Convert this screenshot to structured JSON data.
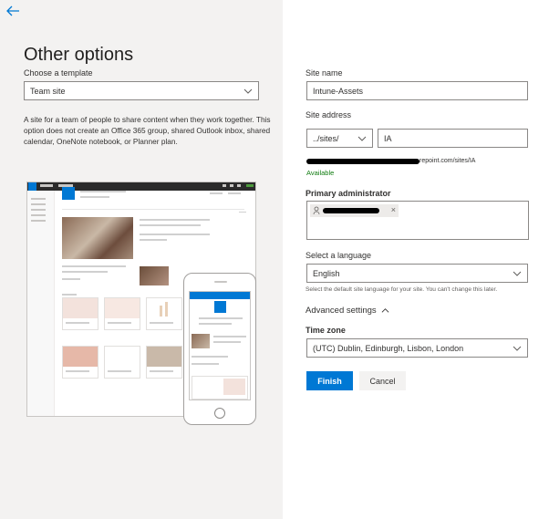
{
  "left": {
    "title": "Other options",
    "template_label": "Choose a template",
    "template_value": "Team site",
    "description": "A site for a team of people to share content when they work together. This option does not create an Office 365 group, shared Outlook inbox, shared calendar, OneNote notebook, or Planner plan.",
    "preview": {
      "suite_brand": "Office 365",
      "app_name": "SharePoint"
    }
  },
  "right": {
    "site_name_label": "Site name",
    "site_name_value": "Intune-Assets",
    "site_address_label": "Site address",
    "site_address_path": "../sites/",
    "site_address_value": "IA",
    "url_tail": "repoint.com/sites/IA",
    "available_text": "Available",
    "primary_admin_label": "Primary administrator",
    "language_label": "Select a language",
    "language_value": "English",
    "language_hint": "Select the default site language for your site. You can't change this later.",
    "advanced_settings": "Advanced settings",
    "time_zone_label": "Time zone",
    "time_zone_value": "(UTC) Dublin, Edinburgh, Lisbon, London",
    "finish_label": "Finish",
    "cancel_label": "Cancel"
  },
  "colors": {
    "accent": "#0078d4",
    "panel_bg": "#f3f2f1",
    "available": "#107c10"
  }
}
